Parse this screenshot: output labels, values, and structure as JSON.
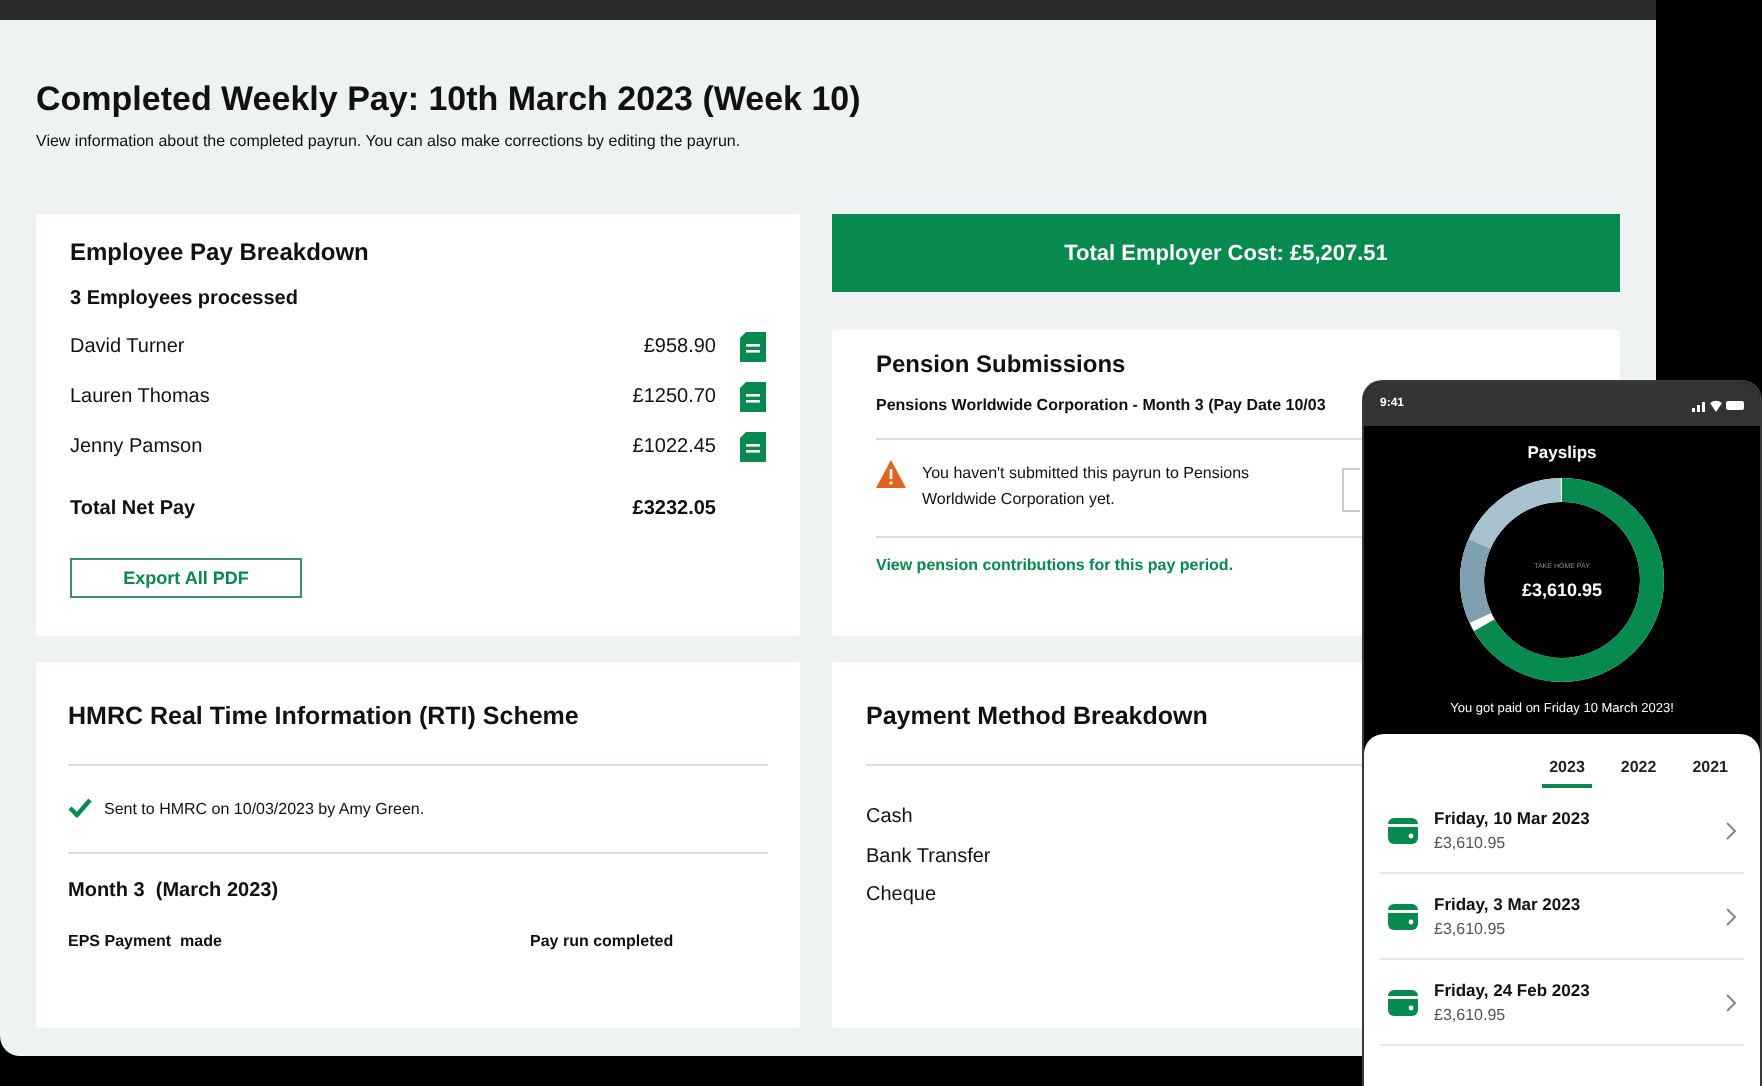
{
  "page": {
    "title": "Completed Weekly Pay: 10th March 2023 (Week 10)",
    "subtitle": "View information about the completed payrun. You can also make corrections by editing the payrun."
  },
  "employee_pay": {
    "title": "Employee Pay Breakdown",
    "count": "3 Employees processed",
    "employees": [
      {
        "name": "David Turner",
        "amount": "£958.90"
      },
      {
        "name": "Lauren Thomas",
        "amount": "£1250.70"
      },
      {
        "name": "Jenny Pamson",
        "amount": "£1022.45"
      }
    ],
    "total_label": "Total Net Pay",
    "total": "£3232.05",
    "button": "Export All PDF"
  },
  "employer_cost": "Total Employer Cost: £5,207.51",
  "pension": {
    "title": "Pension Submissions",
    "provider": "Pensions Worldwide Corporation - Month 3 (Pay Date 10/03",
    "warning": "You haven't submitted this payrun to Pensions Worldwide Corporation yet.",
    "link": "View pension contributions for this pay period."
  },
  "rti": {
    "title": "HMRC Real Time Information (RTI) Scheme",
    "status": "Sent to HMRC on 10/03/2023 by Amy Green.",
    "period": "Month 3  (March 2023)",
    "column_1": "EPS Payment  made",
    "column_2": "Pay run completed"
  },
  "payment_methods": {
    "title": "Payment Method Breakdown",
    "methods": [
      "Cash",
      "Bank Transfer",
      "Cheque"
    ]
  },
  "phone": {
    "time": "9:41",
    "title": "Payslips",
    "donut_label": "TAKE HOME PAY",
    "donut_value": "£3,610.95",
    "message": "You got paid on Friday 10 March 2023!",
    "years": [
      {
        "label": "2023",
        "selected": true
      },
      {
        "label": "2022",
        "selected": false
      },
      {
        "label": "2021",
        "selected": false
      }
    ],
    "payslips": [
      {
        "date": "Friday, 10 Mar 2023",
        "amount": "£3,610.95"
      },
      {
        "date": "Friday, 3 Mar 2023",
        "amount": "£3,610.95"
      },
      {
        "date": "Friday, 24 Feb 2023",
        "amount": "£3,610.95"
      }
    ]
  }
}
